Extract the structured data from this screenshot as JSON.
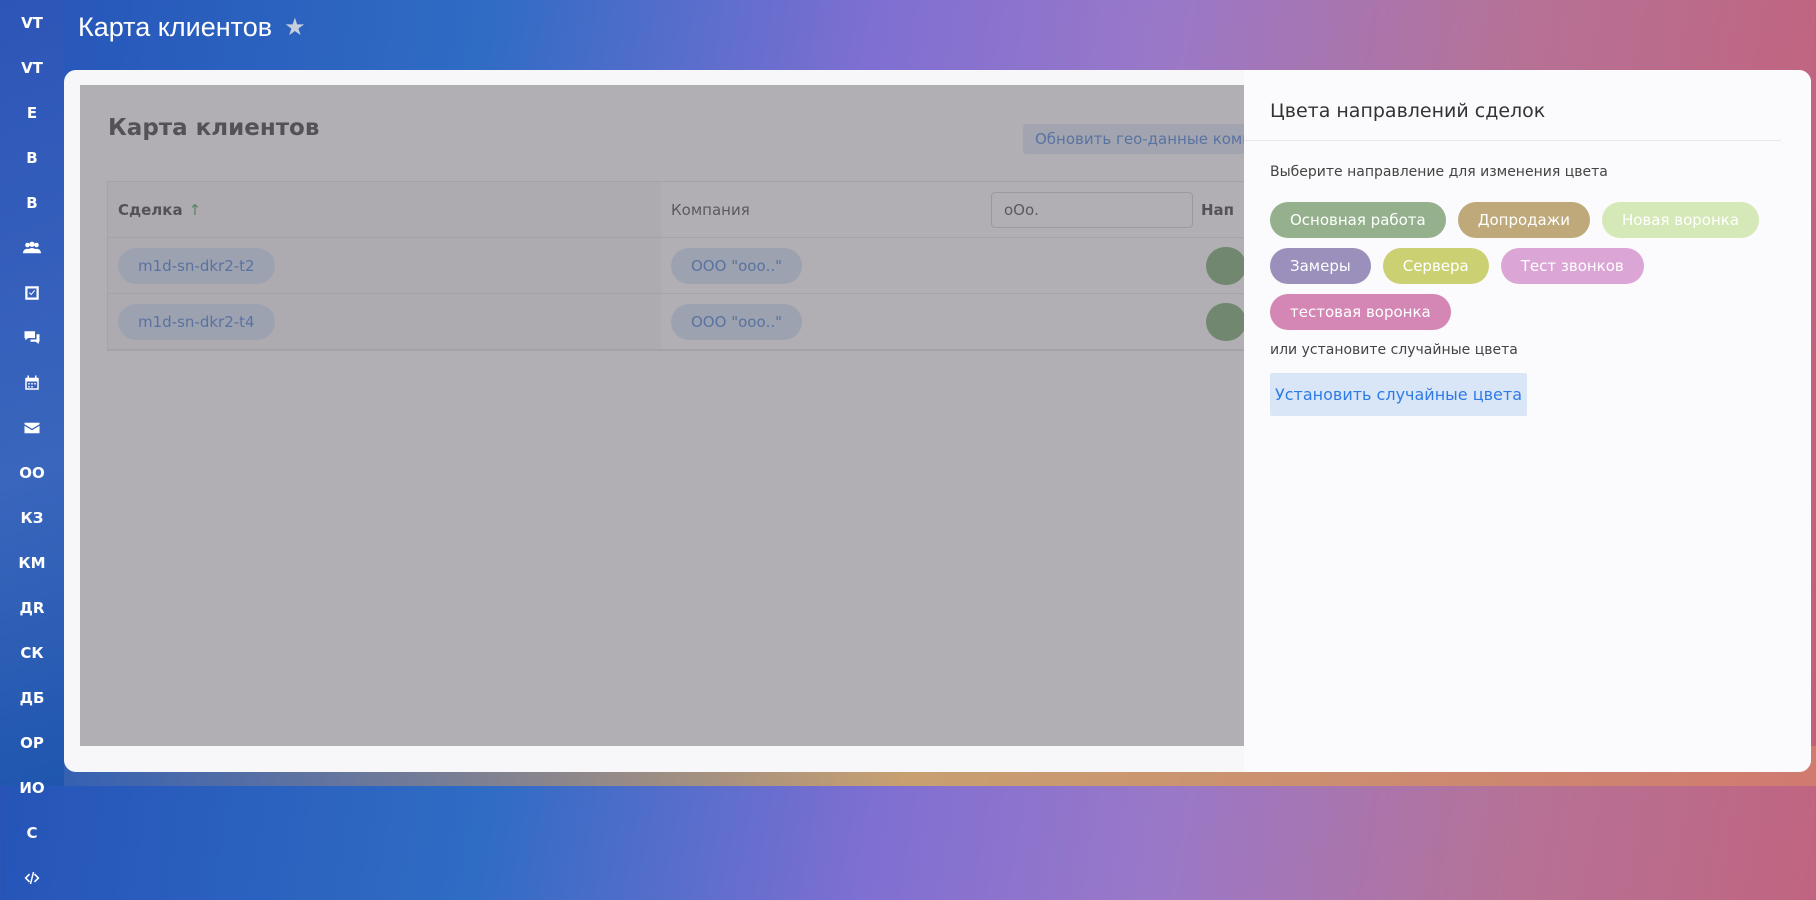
{
  "sidebar": {
    "items": [
      "VT",
      "VT",
      "E",
      "B",
      "B",
      "users-icon",
      "task-icon",
      "chat-icon",
      "calendar-icon",
      "mail-icon",
      "OO",
      "КЗ",
      "КМ",
      "ДR",
      "СК",
      "ДБ",
      "ОР",
      "ИО",
      "С",
      "code-icon"
    ]
  },
  "header": {
    "title": "Карта клиентов"
  },
  "main": {
    "title": "Карта клиентов",
    "geo_button": "Обновить гео-данные компаний",
    "columns": {
      "deal": "Сделка",
      "company": "Компания",
      "direction": "Нап"
    },
    "search_value": "оОо.",
    "rows": [
      {
        "deal": "m1d-sn-dkr2-t2",
        "company": "ООО \"ооо..\""
      },
      {
        "deal": "m1d-sn-dkr2-t4",
        "company": "ООО \"ооо..\""
      }
    ]
  },
  "panel": {
    "title": "Цвета направлений сделок",
    "subtitle": "Выберите направление для изменения цвета",
    "chips": [
      {
        "label": "Основная работа",
        "color": "#94b08c"
      },
      {
        "label": "Допродажи",
        "color": "#bfa97a"
      },
      {
        "label": "Новая воронка",
        "color": "#d5e8b7"
      },
      {
        "label": "Замеры",
        "color": "#9b8fbb"
      },
      {
        "label": "Сервера",
        "color": "#cbd173"
      },
      {
        "label": "Тест звонков",
        "color": "#dba6d6"
      },
      {
        "label": "тестовая воронка",
        "color": "#d486b4"
      }
    ],
    "random_label": "или установите случайные цвета",
    "random_button": "Установить случайные цвета"
  }
}
